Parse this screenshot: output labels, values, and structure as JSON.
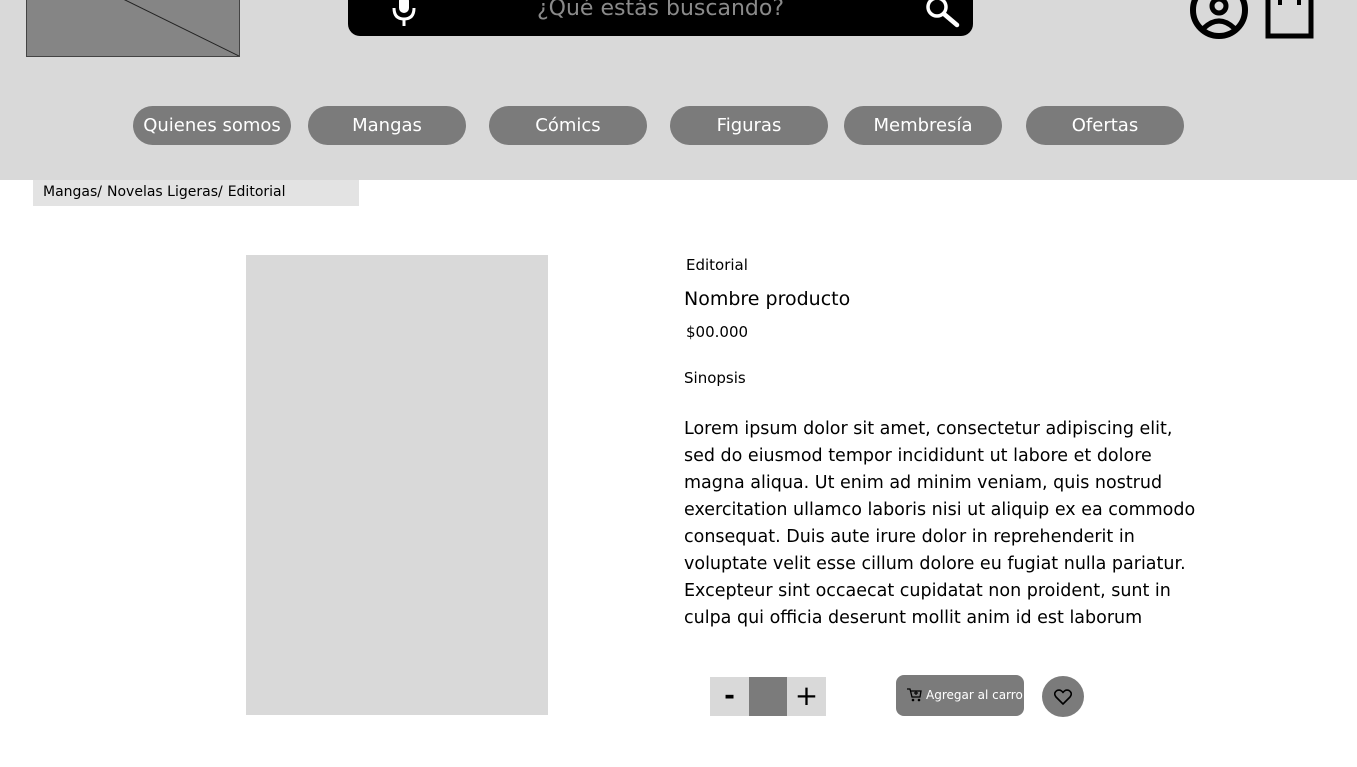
{
  "search": {
    "placeholder": "¿Qué estás buscando?"
  },
  "icons": {
    "logo": "logo-placeholder-image",
    "mic": "microphone-icon",
    "search": "magnifier-icon",
    "user": "user-account-icon",
    "bag": "shopping-bag-icon",
    "cart": "cart-icon",
    "favorite": "heart-icon"
  },
  "nav": {
    "items": [
      "Quienes somos",
      "Mangas",
      "Cómics",
      "Figuras",
      "Membresía",
      "Ofertas"
    ]
  },
  "breadcrumb": [
    "Mangas/",
    "Novelas Ligeras/",
    "Editorial"
  ],
  "product": {
    "editorial": "Editorial",
    "name": "Nombre producto",
    "price": "$00.000",
    "synopsis_label": "Sinopsis",
    "synopsis": "Lorem ipsum dolor sit amet, consectetur adipiscing elit, sed do eiusmod tempor incididunt ut labore et dolore magna aliqua. Ut enim ad minim veniam, quis nostrud exercitation ullamco laboris nisi ut aliquip ex ea commodo consequat. Duis aute irure dolor in reprehenderit in voluptate velit esse cillum dolore eu fugiat nulla pariatur. Excepteur sint occaecat cupidatat non proident, sunt in culpa qui officia deserunt mollit anim id est laborum"
  },
  "actions": {
    "minus_label": "-",
    "plus_label": "+",
    "add_to_cart_label": "Agregar al carro"
  },
  "colors": {
    "header_bg": "#d9d9d9",
    "button_gray": "#7b7b7b",
    "search_bg": "#000000"
  }
}
